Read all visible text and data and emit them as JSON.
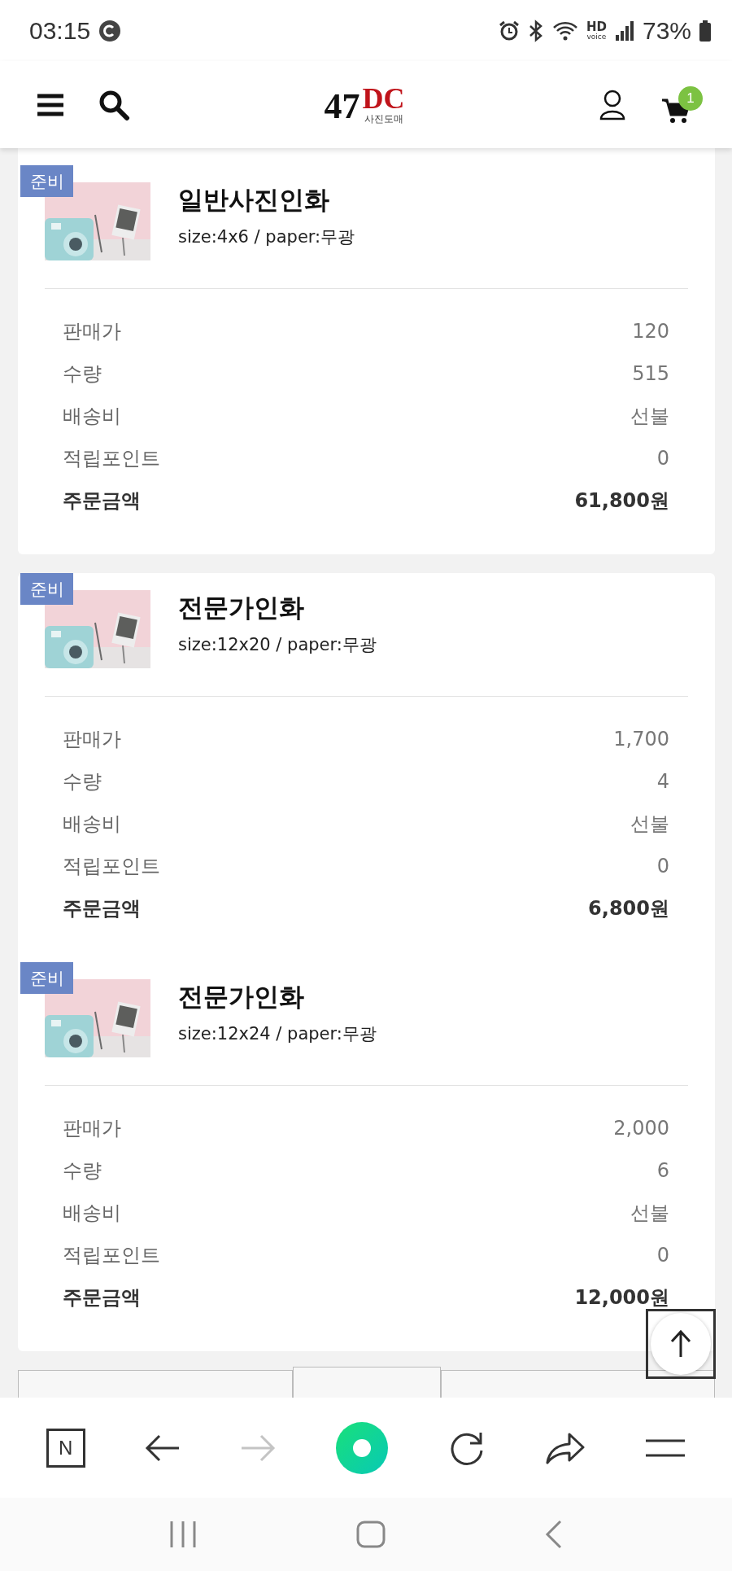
{
  "status_bar": {
    "time": "03:15",
    "hd": "HD",
    "voice": "voice",
    "battery": "73%"
  },
  "header": {
    "logo": {
      "number": "47",
      "letters": "DC",
      "subtitle": "사진도매"
    },
    "cart_count": "1"
  },
  "order_groups": [
    {
      "items": [
        {
          "status": "준비",
          "name": "일반사진인화",
          "options": "size:4x6 / paper:무광",
          "rows": [
            {
              "kind": "normal",
              "label": "판매가",
              "value": "120"
            },
            {
              "kind": "normal",
              "label": "수량",
              "value": "515"
            },
            {
              "kind": "normal",
              "label": "배송비",
              "value": "선불"
            },
            {
              "kind": "normal",
              "label": "적립포인트",
              "value": "0"
            },
            {
              "kind": "total",
              "label": "주문금액",
              "value": "61,800원"
            }
          ]
        }
      ]
    },
    {
      "items": [
        {
          "status": "준비",
          "name": "전문가인화",
          "options": "size:12x20 / paper:무광",
          "rows": [
            {
              "kind": "normal",
              "label": "판매가",
              "value": "1,700"
            },
            {
              "kind": "normal",
              "label": "수량",
              "value": "4"
            },
            {
              "kind": "normal",
              "label": "배송비",
              "value": "선불"
            },
            {
              "kind": "normal",
              "label": "적립포인트",
              "value": "0"
            },
            {
              "kind": "total",
              "label": "주문금액",
              "value": "6,800원"
            }
          ]
        },
        {
          "status": "준비",
          "name": "전문가인화",
          "options": "size:12x24 / paper:무광",
          "rows": [
            {
              "kind": "normal",
              "label": "판매가",
              "value": "2,000"
            },
            {
              "kind": "normal",
              "label": "수량",
              "value": "6"
            },
            {
              "kind": "normal",
              "label": "배송비",
              "value": "선불"
            },
            {
              "kind": "normal",
              "label": "적립포인트",
              "value": "0"
            },
            {
              "kind": "total",
              "label": "주문금액",
              "value": "12,000원"
            }
          ]
        }
      ]
    }
  ],
  "browser": {
    "home_label": "N",
    "forward_disabled": true
  }
}
